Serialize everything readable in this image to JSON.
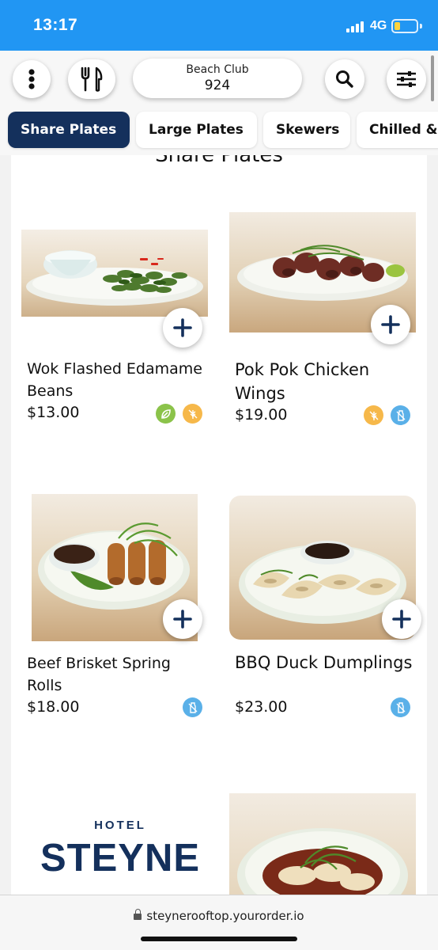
{
  "status_bar": {
    "time": "13:17",
    "network": "4G",
    "battery_level": 0.25,
    "battery_color": "#ffd33d",
    "background": "#2196f3"
  },
  "header": {
    "menu_icon": "more-vertical-icon",
    "restaurant_icon": "fork-knife-icon",
    "venue_name": "Beach Club",
    "table_number": "924",
    "search_icon": "search-icon",
    "filter_icon": "sliders-icon"
  },
  "tabs": [
    {
      "label": "Share Plates",
      "active": true
    },
    {
      "label": "Large Plates",
      "active": false
    },
    {
      "label": "Skewers",
      "active": false
    },
    {
      "label": "Chilled &",
      "active": false
    }
  ],
  "section": {
    "title": "Share Plates"
  },
  "items": [
    {
      "name": "Wok Flashed Edamame Beans",
      "price": "$13.00",
      "diet_icons": [
        "vegan-leaf-icon",
        "gluten-free-icon"
      ]
    },
    {
      "name": "Pok Pok Chicken Wings",
      "price": "$19.00",
      "diet_icons": [
        "gluten-free-icon",
        "dairy-free-icon"
      ]
    },
    {
      "name": "Beef Brisket Spring Rolls",
      "price": "$18.00",
      "diet_icons": [
        "dairy-free-icon"
      ]
    },
    {
      "name": "BBQ Duck Dumplings",
      "price": "$23.00",
      "diet_icons": [
        "dairy-free-icon"
      ]
    }
  ],
  "logo": {
    "line1": "HOTEL",
    "line2": "STEYNE"
  },
  "browser": {
    "url": "steynerooftop.yourorder.io"
  },
  "colors": {
    "accent_navy": "#14305c",
    "diet_green": "#8bc34a",
    "diet_orange": "#f6b84a",
    "diet_blue": "#5ab0e8"
  }
}
